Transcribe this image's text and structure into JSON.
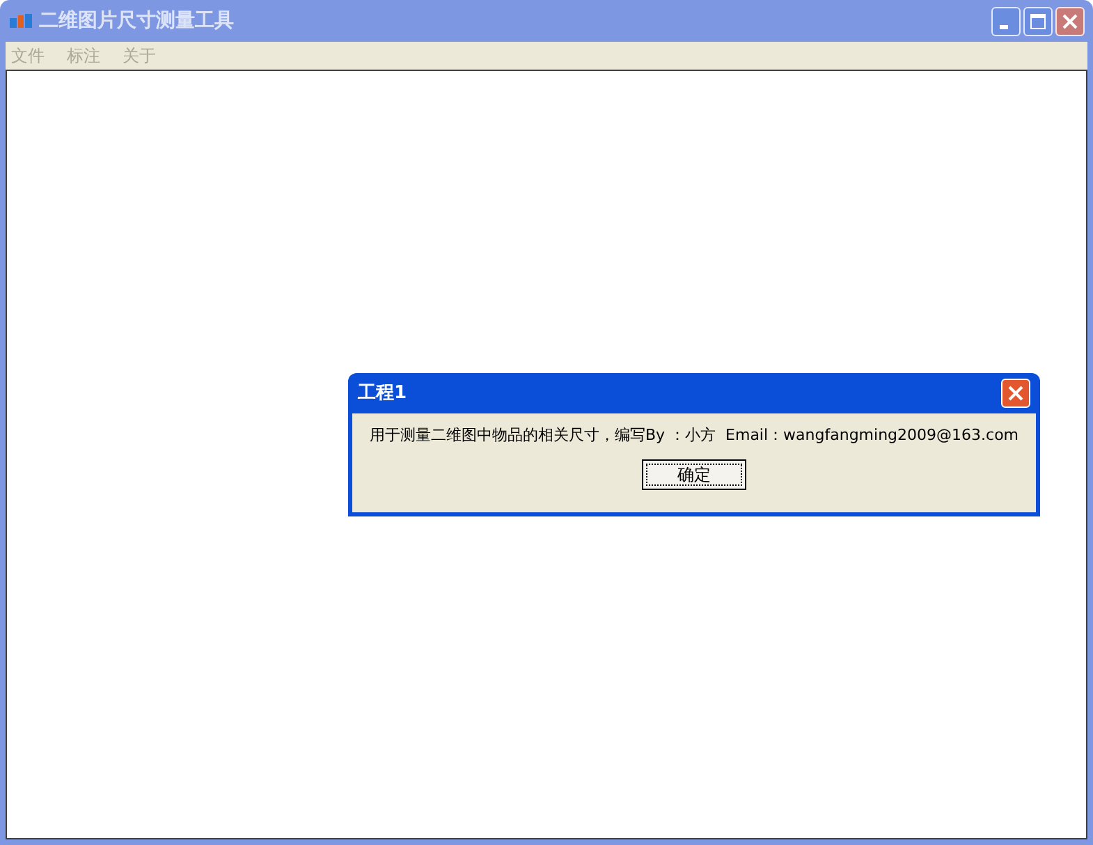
{
  "window": {
    "title": "二维图片尺寸测量工具",
    "active": false
  },
  "menu": [
    {
      "label": "文件",
      "disabled": true
    },
    {
      "label": "标注",
      "disabled": true
    },
    {
      "label": "关于",
      "disabled": true
    }
  ],
  "dialog": {
    "title": "工程1",
    "message": "用于测量二维图中物品的相关尺寸，编写By ：小方  Email：wangfangming2009@163.com",
    "button": "确定"
  }
}
